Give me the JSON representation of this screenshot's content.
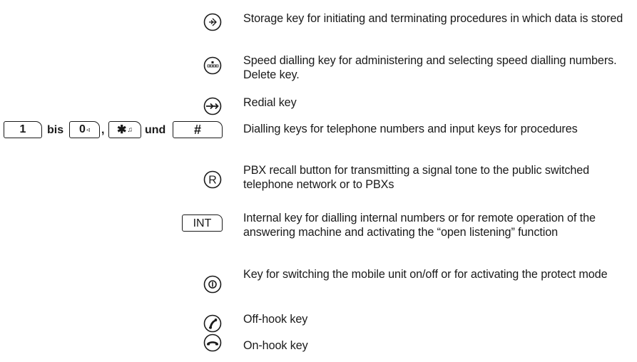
{
  "entries": [
    {
      "icon": "storage-icon",
      "text": "Storage key for initiating and terminating procedures in which data is stored"
    },
    {
      "icon": "speed-dial-icon",
      "text": "Speed dialling key for administering and selecting speed dialling numbers. Delete key."
    },
    {
      "icon": "redial-icon",
      "text": "Redial key"
    },
    {
      "icon": "dialling-keys",
      "text": "Dialling keys for telephone numbers and input keys for procedures"
    },
    {
      "icon": "recall-r-icon",
      "text": "PBX recall button for transmitting a signal tone to the public switched telephone network or to PBXs"
    },
    {
      "icon": "int-key",
      "text": "Internal key for dialling internal numbers or for remote operation of the answering machine and activating the “open listening” function"
    },
    {
      "icon": "power-icon",
      "text": "Key for switching the mobile unit on/off or for activating the protect mode"
    },
    {
      "icon": "off-hook-icon",
      "text": "Off-hook key"
    },
    {
      "icon": "on-hook-icon",
      "text": "On-hook key"
    }
  ],
  "dialling_keys": {
    "key1": "1",
    "word_bis": "bis",
    "key0": "0",
    "key0_sub": "◃",
    "comma": ",",
    "key_star": "✱",
    "key_star_sub": "♫",
    "word_und": "und",
    "key_hash": "#"
  },
  "int_label": "INT",
  "recall_label": "R"
}
